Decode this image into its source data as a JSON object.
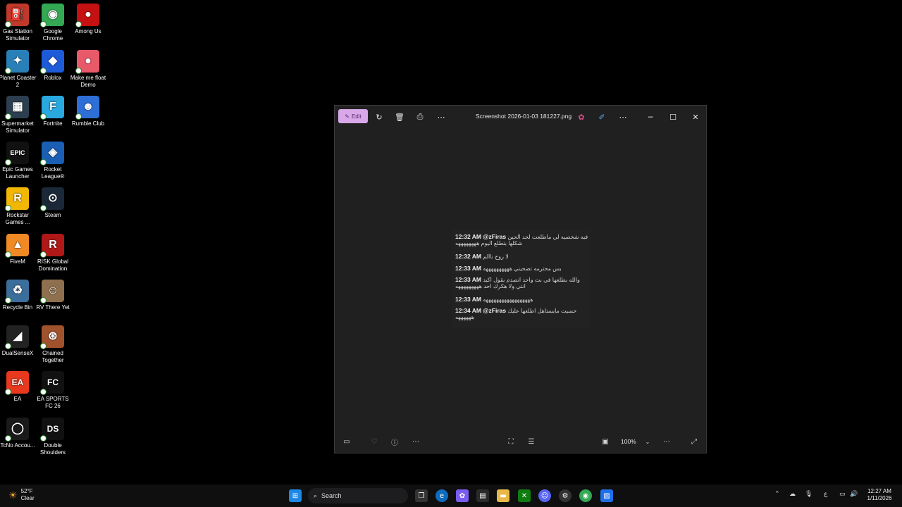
{
  "desktop": {
    "icons": [
      {
        "label": "Gas Station Simulator",
        "name": "gas-station-simulator-icon",
        "color": "#c0392b",
        "glyph": "⛽"
      },
      {
        "label": "Google Chrome",
        "name": "google-chrome-icon",
        "color": "#34a853",
        "glyph": "◉"
      },
      {
        "label": "Among Us",
        "name": "among-us-icon",
        "color": "#c51111",
        "glyph": "●"
      },
      {
        "label": "Planet Coaster 2",
        "name": "planet-coaster-icon",
        "color": "#2980b9",
        "glyph": "✦"
      },
      {
        "label": "Roblox",
        "name": "roblox-icon",
        "color": "#1e5bd8",
        "glyph": "◆"
      },
      {
        "label": "Make me float Demo",
        "name": "make-me-float-icon",
        "color": "#e85a6a",
        "glyph": "●"
      },
      {
        "label": "Supermarket Simulator",
        "name": "supermarket-simulator-icon",
        "color": "#2c3e50",
        "glyph": "▦"
      },
      {
        "label": "Fortnite",
        "name": "fortnite-icon",
        "color": "#2aa8e0",
        "glyph": "F"
      },
      {
        "label": "Rumble Club",
        "name": "rumble-club-icon",
        "color": "#2d6fd6",
        "glyph": "☻"
      },
      {
        "label": "Epic Games Launcher",
        "name": "epic-games-icon",
        "color": "#111111",
        "glyph": "EPIC"
      },
      {
        "label": "Rocket League®",
        "name": "rocket-league-icon",
        "color": "#1a5fb4",
        "glyph": "◈"
      },
      {
        "label": "Rockstar Games ...",
        "name": "rockstar-games-icon",
        "color": "#f2b705",
        "glyph": "R"
      },
      {
        "label": "Steam",
        "name": "steam-icon",
        "color": "#1b2838",
        "glyph": "⊙"
      },
      {
        "label": "FiveM",
        "name": "fivem-icon",
        "color": "#f08a24",
        "glyph": "▲"
      },
      {
        "label": "RISK Global Domination",
        "name": "risk-global-domination-icon",
        "color": "#b01818",
        "glyph": "R"
      },
      {
        "label": "Recycle Bin",
        "name": "recycle-bin-icon",
        "color": "#3c6e9c",
        "glyph": "♻"
      },
      {
        "label": "RV There Yet",
        "name": "rv-there-yet-icon",
        "color": "#8e6f4e",
        "glyph": "☺"
      },
      {
        "label": "DualSenseX",
        "name": "dualsensex-icon",
        "color": "#222222",
        "glyph": "◢"
      },
      {
        "label": "Chained Together",
        "name": "chained-together-icon",
        "color": "#a0522d",
        "glyph": "⊛"
      },
      {
        "label": "EA",
        "name": "ea-icon",
        "color": "#e8391f",
        "glyph": "EA"
      },
      {
        "label": "EA SPORTS FC 26",
        "name": "ea-sports-fc-icon",
        "color": "#111111",
        "glyph": "FC"
      },
      {
        "label": "TcNo Accou...",
        "name": "tcno-account-switcher-icon",
        "color": "#1a1a1a",
        "glyph": "◯"
      },
      {
        "label": "Double Shoulders",
        "name": "double-shoulders-icon",
        "color": "#111111",
        "glyph": "DS"
      }
    ]
  },
  "window": {
    "title": "Screenshot 2026-01-03 181227.png",
    "edit_label": "Edit",
    "zoom_label": "100%",
    "chat": [
      {
        "time": "12:32 AM",
        "user": "@zFiras",
        "text": "فيه شخصيه لي ماطلعت لحد الحين شكلها بتطلع اليوم ههههههههه"
      },
      {
        "time": "12:32 AM",
        "user": "",
        "text": "لا روح ناالم"
      },
      {
        "time": "12:33 AM",
        "user": "",
        "text": "بس محترمه تضحيني ههههههههههه"
      },
      {
        "time": "12:33 AM",
        "user": "",
        "text": "والله بطلعها في بث واحد انصدم بقول اكيد انتي ولا هكرك احد هههههههههه"
      },
      {
        "time": "12:33 AM",
        "user": "",
        "text": "ههههههههههههههههههه"
      },
      {
        "time": "12:34 AM",
        "user": "@zFiras",
        "text": "حسيت مايستاهل اطلعها عليك ههههههه"
      }
    ]
  },
  "taskbar": {
    "weather_temp": "52°F",
    "weather_desc": "Clear",
    "search_placeholder": "Search",
    "time": "12:27 AM",
    "date": "1/11/2026",
    "lang": "ع"
  }
}
